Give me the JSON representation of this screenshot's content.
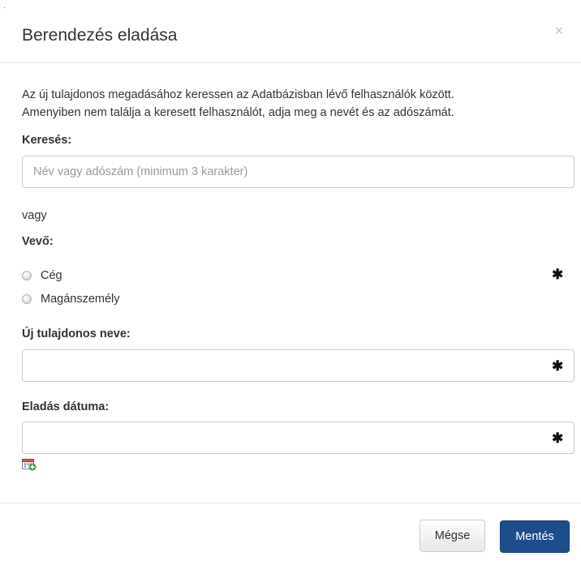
{
  "dialog": {
    "title": "Berendezés eladása",
    "close_label": "×"
  },
  "intro": {
    "line1": "Az új tulajdonos megadásához keressen az Adatbázisban lévő felhasználók között.",
    "line2": "Amenyiben nem találja a keresett felhasználót, adja meg a nevét és az adószámát."
  },
  "search": {
    "label": "Keresés:",
    "placeholder": "Név vagy adószám (minimum 3 karakter)",
    "value": ""
  },
  "separator_text": "vagy",
  "buyer": {
    "label": "Vevő:",
    "options": [
      {
        "label": "Cég",
        "selected": false
      },
      {
        "label": "Magánszemély",
        "selected": false
      }
    ],
    "required_marker": "✱"
  },
  "owner_name": {
    "label": "Új tulajdonos neve:",
    "value": "",
    "required_marker": "✱"
  },
  "sale_date": {
    "label": "Eladás dátuma:",
    "value": "",
    "required_marker": "✱",
    "calendar_icon": "calendar-add-icon"
  },
  "footer": {
    "cancel_label": "Mégse",
    "save_label": "Mentés"
  },
  "colors": {
    "primary": "#1e4d8c",
    "border": "#cccccc",
    "text": "#333333",
    "placeholder": "#999999"
  }
}
